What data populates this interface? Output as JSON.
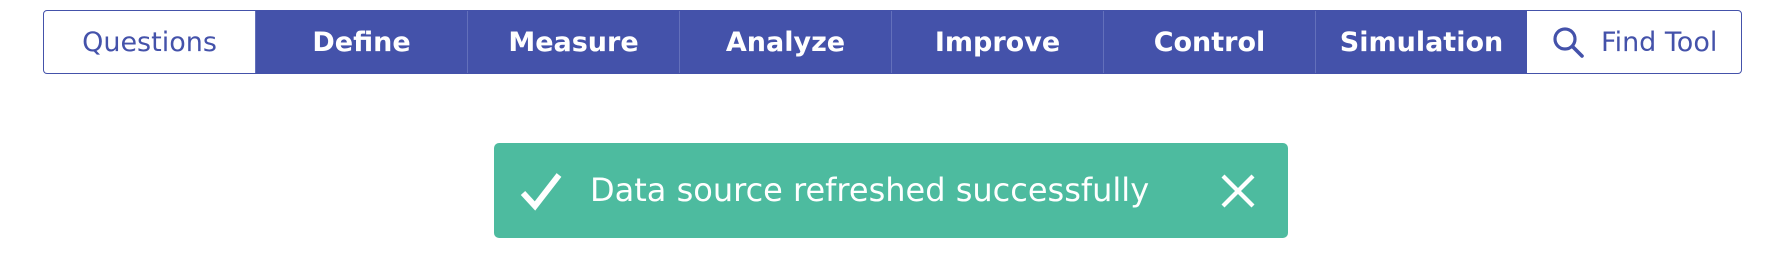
{
  "toolbar": {
    "items": [
      {
        "label": "Questions"
      },
      {
        "label": "Define"
      },
      {
        "label": "Measure"
      },
      {
        "label": "Analyze"
      },
      {
        "label": "Improve"
      },
      {
        "label": "Control"
      },
      {
        "label": "Simulation"
      },
      {
        "label": "Find Tool",
        "icon": "search-icon"
      }
    ]
  },
  "notification": {
    "message": "Data source refreshed successfully",
    "status_icon": "check-icon",
    "dismiss_icon": "close-icon",
    "color": "#4dbb9f"
  },
  "colors": {
    "primary": "#4452aa",
    "background": "#ffffff",
    "success": "#4dbb9f"
  }
}
